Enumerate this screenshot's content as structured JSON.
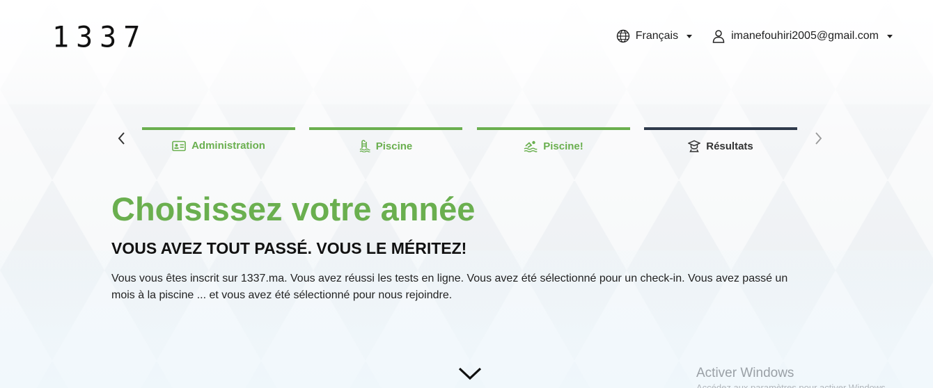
{
  "header": {
    "logo": "1337",
    "language": {
      "label": "Français",
      "icon": "globe-icon"
    },
    "user": {
      "email": "imanefouhiri2005@gmail.com",
      "icon": "user-icon"
    }
  },
  "steps": [
    {
      "label": "Administration",
      "icon": "id-card-icon",
      "status": "done"
    },
    {
      "label": "Piscine",
      "icon": "pool-ladder-icon",
      "status": "done"
    },
    {
      "label": "Piscine!",
      "icon": "swimmer-icon",
      "status": "done"
    },
    {
      "label": "Résultats",
      "icon": "graduation-icon",
      "status": "active"
    }
  ],
  "main": {
    "title": "Choisissez votre année",
    "subtitle": "VOUS AVEZ TOUT PASSÉ. VOUS LE MÉRITEZ!",
    "description": "Vous vous êtes inscrit sur 1337.ma. Vous avez réussi les tests en ligne. Vous avez été sélectionné pour un check-in. Vous avez passé un mois à la piscine ... et vous avez été sélectionné pour nous rejoindre."
  },
  "watermark": {
    "title": "Activer Windows",
    "subtitle": "Accédez aux paramètres pour activer Windows."
  },
  "colors": {
    "accent": "#6aaf4f",
    "active_bar": "#2f3a4c"
  }
}
